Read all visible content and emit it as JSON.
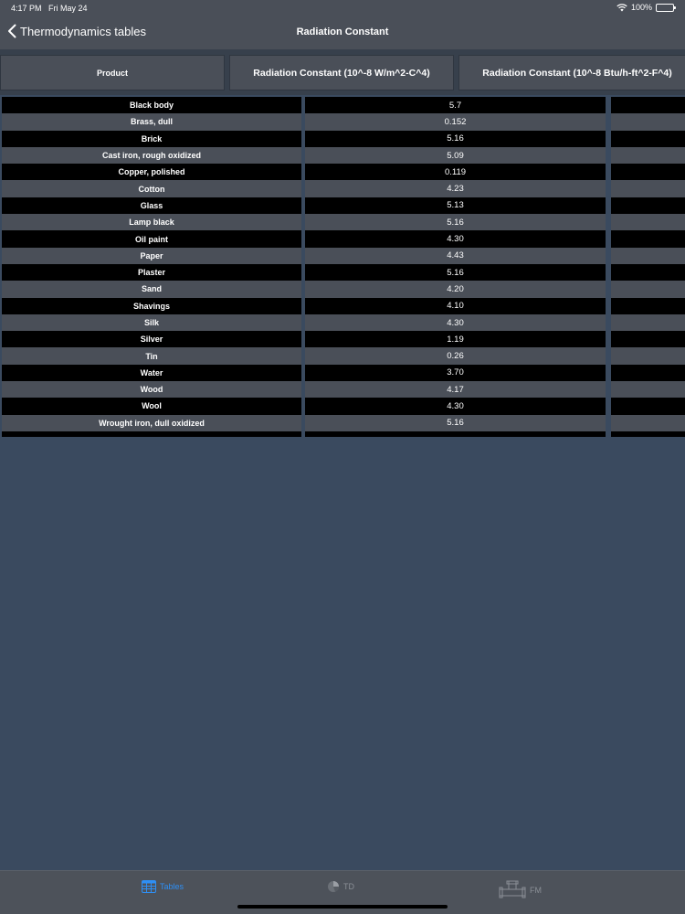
{
  "status": {
    "time": "4:17 PM",
    "date": "Fri May 24",
    "battery": "100%"
  },
  "nav": {
    "back_label": "Thermodynamics tables",
    "title": "Radiation Constant"
  },
  "columns": [
    "Product",
    "Radiation Constant (10^-8  W/m^2-C^4)",
    "Radiation Constant (10^-8  Btu/h-ft^2-F^4)"
  ],
  "rows": [
    {
      "product": "Black body",
      "si": "5.7",
      "imp": ""
    },
    {
      "product": "Brass, dull",
      "si": "0.152",
      "imp": ""
    },
    {
      "product": "Brick",
      "si": "5.16",
      "imp": ""
    },
    {
      "product": "Cast iron, rough oxidized",
      "si": "5.09",
      "imp": ""
    },
    {
      "product": "Copper, polished",
      "si": "0.119",
      "imp": ""
    },
    {
      "product": "Cotton",
      "si": "4.23",
      "imp": ""
    },
    {
      "product": "Glass",
      "si": "5.13",
      "imp": ""
    },
    {
      "product": "Lamp black",
      "si": "5.16",
      "imp": ""
    },
    {
      "product": "Oil paint",
      "si": "4.30",
      "imp": ""
    },
    {
      "product": "Paper",
      "si": "4.43",
      "imp": ""
    },
    {
      "product": "Plaster",
      "si": "5.16",
      "imp": ""
    },
    {
      "product": "Sand",
      "si": "4.20",
      "imp": ""
    },
    {
      "product": "Shavings",
      "si": "4.10",
      "imp": ""
    },
    {
      "product": "Silk",
      "si": "4.30",
      "imp": ""
    },
    {
      "product": "Silver",
      "si": "1.19",
      "imp": ""
    },
    {
      "product": "Tin",
      "si": "0.26",
      "imp": ""
    },
    {
      "product": "Water",
      "si": "3.70",
      "imp": ""
    },
    {
      "product": "Wood",
      "si": "4.17",
      "imp": ""
    },
    {
      "product": "Wool",
      "si": "4.30",
      "imp": ""
    },
    {
      "product": "Wrought iron, dull oxidized",
      "si": "5.16",
      "imp": ""
    }
  ],
  "tabs": [
    {
      "label": "Tables",
      "icon": "table-icon",
      "active": true
    },
    {
      "label": "TD",
      "icon": "pie-chart-icon",
      "active": false
    },
    {
      "label": "FM",
      "icon": "pipe-fitting-icon",
      "active": false
    }
  ],
  "colors": {
    "background": "#3a4a5f",
    "bar": "#4a4f58",
    "accent": "#2e8ff5"
  }
}
